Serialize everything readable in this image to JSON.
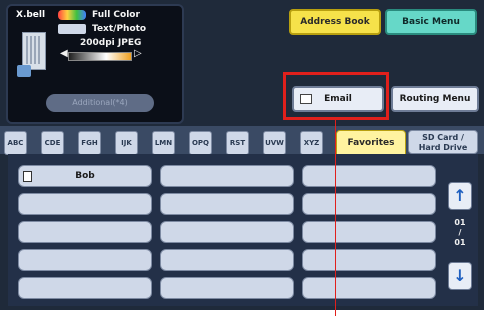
{
  "status": {
    "filename": "X.bell",
    "color_mode": "Full Color",
    "scan_mode": "Text/Photo",
    "resolution": "200dpi JPEG",
    "contrast_left": "◀",
    "contrast_right": "▷",
    "additional_label": "Additional(*4)"
  },
  "header": {
    "address_book": "Address Book",
    "basic_menu": "Basic Menu"
  },
  "actions": {
    "email": "Email",
    "routing": "Routing Menu"
  },
  "tabs": [
    "ABC",
    "CDE",
    "FGH",
    "IJK",
    "LMN",
    "OPQ",
    "RST",
    "UVW",
    "XYZ"
  ],
  "favorites_tab": "Favorites",
  "sd_tab": [
    "SD Card /",
    "Hard Drive"
  ],
  "slots": {
    "row1_col1": "Bob"
  },
  "pager": {
    "current": "01",
    "sep": "/",
    "total": "01"
  },
  "colors": {
    "highlight": "#e0201c",
    "address_book": "#f6e24a",
    "basic_menu": "#66d8c8"
  }
}
